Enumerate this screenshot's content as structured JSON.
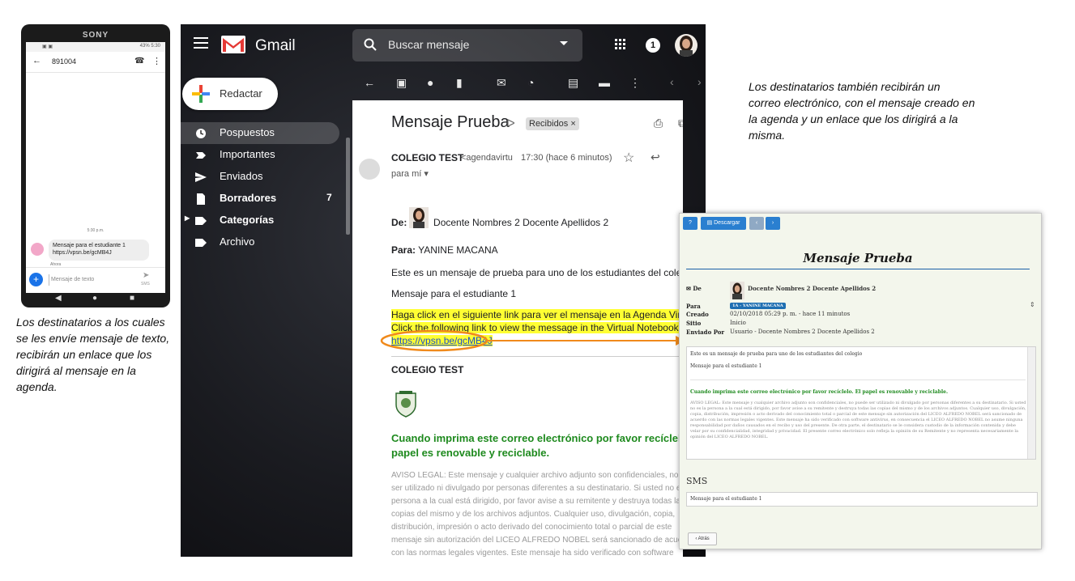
{
  "colors": {
    "gmail_bg": "#1a1b20",
    "highlight": "#ffff33",
    "link": "#1a4fcc",
    "green": "#1e8a1e",
    "annotation": "#f08a1c",
    "agenda_button": "#2a7fd0"
  },
  "phone": {
    "brand": "SONY",
    "status_right": "43% 5:30",
    "contact_number": "891004",
    "message_time": "5:30 p.m.",
    "message_line1": "Mensaje para el estudiante 1",
    "message_line2": "https://vpsn.be/gcMB4J",
    "message_status": "Ahora",
    "compose_placeholder": "Mensaje de texto",
    "send_label": "SMS"
  },
  "captions": {
    "left": "Los destinatarios a los cuales se les envíe mensaje de texto, recibirán un enlace que los dirigirá al mensaje en la agenda.",
    "right": "Los destinatarios también recibirán un correo electrónico, con el mensaje creado en la agenda y un enlace que los dirigirá a la misma."
  },
  "gmail": {
    "wordmark": "Gmail",
    "search_placeholder": "Buscar mensaje",
    "notification_count": "1",
    "compose_label": "Redactar",
    "nav": [
      {
        "label": "Pospuestos",
        "icon": "clock-icon",
        "count": ""
      },
      {
        "label": "Importantes",
        "icon": "important-icon",
        "count": ""
      },
      {
        "label": "Enviados",
        "icon": "send-icon",
        "count": ""
      },
      {
        "label": "Borradores",
        "icon": "draft-icon",
        "count": "7"
      },
      {
        "label": "Categorías",
        "icon": "label-icon",
        "count": ""
      },
      {
        "label": "Archivo",
        "icon": "label-icon",
        "count": ""
      }
    ],
    "mail": {
      "subject": "Mensaje Prueba",
      "label": "Recibidos ×",
      "sender_name": "COLEGIO TEST",
      "sender_email": "<agendavirtu",
      "time": "17:30 (hace 6 minutos)",
      "to": "para mí",
      "de_label": "De:",
      "de_value": "Docente Nombres 2 Docente Apellidos 2",
      "para_label": "Para:",
      "para_value": "YANINE MACANA",
      "body1": "Este es un mensaje de prueba para uno de los estudiantes del colegio",
      "body2": "Mensaje para el estudiante 1",
      "link_es": "Haga click en el siguiente link para ver el mensaje en la Agenda Virtual.",
      "link_en": "Click the following link to view the message in the Virtual Notebook",
      "link_url": "https://vpsn.be/gcMB4J",
      "signature": "COLEGIO TEST",
      "green1": "Cuando imprima este correo electrónico por favor recíclelo. El",
      "green2": "papel es renovable y reciclable.",
      "legal": [
        "AVISO LEGAL: Este mensaje y cualquier archivo adjunto son confidenciales, no pu",
        "ser utilizado ni divulgado por personas diferentes a su destinatario. Si usted no es l",
        "persona a la cual está dirigido, por favor avise a su remitente y destruya todas las",
        "copias del mismo y de los archivos adjuntos. Cualquier uso, divulgación, copia,",
        "distribución, impresión o acto derivado del conocimiento total o parcial de este",
        "mensaje sin autorización del LICEO ALFREDO NOBEL será sancionado de acuerd",
        "con las normas legales vigentes. Este mensaje ha sido verificado con software"
      ]
    }
  },
  "agenda": {
    "download_label": "Descargar",
    "title": "Mensaje Prueba",
    "de_label": "De",
    "de_value": "Docente Nombres 2 Docente Apellidos 2",
    "para_label": "Para",
    "para_badge": "1A - YANINE MACANA",
    "creado_label": "Creado",
    "creado_value": "02/10/2018  05:29 p. m.  -  hace 11 minutos",
    "sitio_label": "Sitio",
    "sitio_value": "Inicio",
    "enviado_label": "Enviado Por",
    "enviado_value": "Usuario - Docente Nombres 2 Docente Apellidos 2",
    "body1": "Este es un mensaje de prueba para uno de los estudiantes del colegio",
    "body2": "Mensaje para el estudiante 1",
    "green": "Cuando imprima este correo electrónico por favor recíclelo. El papel es renovable y reciclable.",
    "legal": "AVISO LEGAL: Este mensaje y cualquier archivo adjunto son confidenciales, no puede ser utilizado ni divulgado por personas diferentes a su destinatario. Si usted no es la persona a la cual está dirigido, por favor avise a su remitente y destruya todas las copias del mismo y de los archivos adjuntos. Cualquier uso, divulgación, copia, distribución, impresión o acto derivado del conocimiento total o parcial de este mensaje sin autorización del LICEO ALFREDO NOBEL será sancionado de acuerdo con las normas legales vigentes. Este mensaje ha sido verificado con software antivirus, en consecuencia el LICEO ALFREDO NOBEL no asume ninguna responsabilidad por daños causados en el recibo y uso del presente. De otra parte, el destinatario se le considera custodio de la información contenida y debe velar por su confidencialidad, integridad y privacidad. El presente correo electrónico solo refleja la opinión de su Remitente y no representa necesariamente la opinión del LICEO ALFREDO NOBEL.",
    "sms_title": "SMS",
    "sms_value": "Mensaje para el estudiante 1",
    "back_label": "Atrás"
  }
}
